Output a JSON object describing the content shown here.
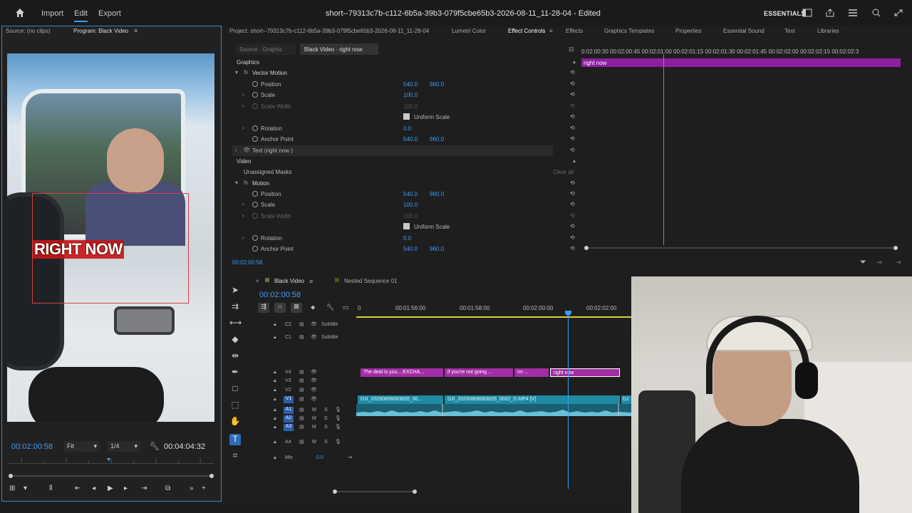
{
  "menu": {
    "import": "Import",
    "edit": "Edit",
    "export": "Export"
  },
  "title": "short--79313c7b-c112-6b5a-39b3-079f5cbe65b3-2026-08-11_11-28-04 - Edited",
  "workspace": "ESSENTIALS",
  "left_panel": {
    "source_tab": "Source: (no clips)",
    "program_tab": "Program: Black Video",
    "overlay_text": "RIGHT NOW",
    "timecode": "00:02:00:58",
    "fit": "Fit",
    "resolution": "1/4",
    "duration": "00:04:04:32"
  },
  "panels": {
    "project": "Project: short--79313c7b-c112-6b5a-39b3-079f5cbe65b3-2026-08-11_11-28-04",
    "lumetri": "Lumetri Color",
    "effect_controls": "Effect Controls",
    "effects": "Effects",
    "graphics_templates": "Graphics Templates",
    "properties": "Properties",
    "essential_sound": "Essential Sound",
    "text": "Text",
    "libraries": "Libraries"
  },
  "effect_controls": {
    "crumb_source": "Source · Graphic",
    "crumb_clip": "Black Video · right now",
    "graphics_header": "Graphics",
    "vector_motion": "Vector Motion",
    "position_label": "Position",
    "position_x": "540.0",
    "position_y": "960.0",
    "scale_label": "Scale",
    "scale_value": "100.0",
    "scale_width_label": "Scale Width",
    "scale_width_value": "100.0",
    "uniform_scale": "Uniform Scale",
    "rotation_label": "Rotation",
    "rotation_value": "0.0",
    "anchor_label": "Anchor Point",
    "anchor_x": "540.0",
    "anchor_y": "960.0",
    "text_layer": "Text (right now )",
    "video_header": "Video",
    "unassigned_masks": "Unassigned Masks",
    "clear_all": "Clear all",
    "motion": "Motion",
    "timecode": "00:02:00:58",
    "ruler": "0:02:00:30   00:02:00:45   00:02:01:00   00:02:01:15   00:02:01:30   00:02:01:45   00:02:02:00   00:02:02:15   00:02:02:3",
    "clip_label": "right now"
  },
  "timeline": {
    "sequence_tab": "Black Video",
    "nested_tab": "Nested Sequence 01",
    "timecode": "00:02:00:58",
    "ruler": {
      "r0": "0",
      "r1": "00:01:56:00",
      "r2": "00:01:58:00",
      "r3": "00:02:00:00",
      "r4": "00:02:02:00"
    },
    "tracks": {
      "c2": "C2",
      "c1": "C1",
      "subtitle": "Subtitle",
      "v4": "V4",
      "v3": "V3",
      "v2": "V2",
      "v1": "V1",
      "a1": "A1",
      "a2": "A2",
      "a3": "A3",
      "a4": "A4",
      "mix": "Mix",
      "mix_value": "0.0"
    },
    "clips": {
      "v4_a": "The deal is you... EXCHA...",
      "v4_b": "if you're not going ...",
      "v4_c": "Im ...",
      "v4_d": "right now",
      "v1_a": "DJI_20260808083826_00...",
      "v1_b": "DJI_20260808083826_0002_D.MP4 [V]",
      "v1_c": "DJ"
    }
  },
  "colors": {
    "accent": "#3c9bf5",
    "graphic_clip": "#a22ea5",
    "video_clip": "#1f8aa3",
    "panel_bg": "#1e1e1e"
  }
}
